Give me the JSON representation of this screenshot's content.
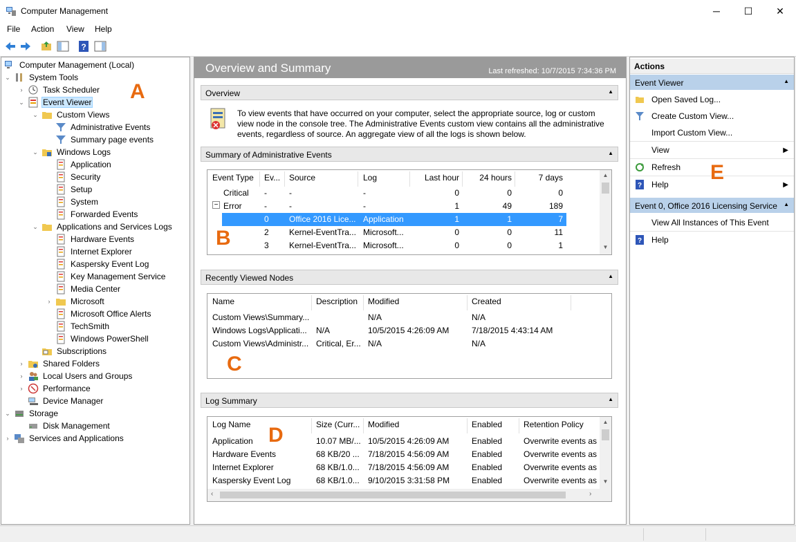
{
  "window": {
    "title": "Computer Management",
    "minimize": "─",
    "maximize": "☐",
    "close": "✕"
  },
  "menu": [
    "File",
    "Action",
    "View",
    "Help"
  ],
  "tree": {
    "root": "Computer Management (Local)",
    "items": [
      {
        "label": "System Tools"
      },
      {
        "label": "Task Scheduler"
      },
      {
        "label": "Event Viewer"
      },
      {
        "label": "Custom Views"
      },
      {
        "label": "Administrative Events"
      },
      {
        "label": "Summary page events"
      },
      {
        "label": "Windows Logs"
      },
      {
        "label": "Application"
      },
      {
        "label": "Security"
      },
      {
        "label": "Setup"
      },
      {
        "label": "System"
      },
      {
        "label": "Forwarded Events"
      },
      {
        "label": "Applications and Services Logs"
      },
      {
        "label": "Hardware Events"
      },
      {
        "label": "Internet Explorer"
      },
      {
        "label": "Kaspersky Event Log"
      },
      {
        "label": "Key Management Service"
      },
      {
        "label": "Media Center"
      },
      {
        "label": "Microsoft"
      },
      {
        "label": "Microsoft Office Alerts"
      },
      {
        "label": "TechSmith"
      },
      {
        "label": "Windows PowerShell"
      },
      {
        "label": "Subscriptions"
      },
      {
        "label": "Shared Folders"
      },
      {
        "label": "Local Users and Groups"
      },
      {
        "label": "Performance"
      },
      {
        "label": "Device Manager"
      },
      {
        "label": "Storage"
      },
      {
        "label": "Disk Management"
      },
      {
        "label": "Services and Applications"
      }
    ]
  },
  "main": {
    "title": "Overview and Summary",
    "refreshed": "Last refreshed: 10/7/2015 7:34:36 PM",
    "overview": {
      "header": "Overview",
      "text": "To view events that have occurred on your computer, select the appropriate source, log or custom view node in the console tree. The Administrative Events custom view contains all the administrative events, regardless of source. An aggregate view of all the logs is shown below."
    },
    "summary": {
      "header": "Summary of Administrative Events",
      "columns": [
        "Event Type",
        "Ev...",
        "Source",
        "Log",
        "Last hour",
        "24 hours",
        "7 days"
      ],
      "rows": [
        {
          "type": "Critical",
          "ev": "-",
          "source": "-",
          "log": "-",
          "hour": "0",
          "day": "0",
          "week": "0"
        },
        {
          "type": "Error",
          "ev": "-",
          "source": "-",
          "log": "-",
          "hour": "1",
          "day": "49",
          "week": "189"
        },
        {
          "type": "",
          "ev": "0",
          "source": "Office 2016 Lice...",
          "log": "Application",
          "hour": "1",
          "day": "1",
          "week": "7"
        },
        {
          "type": "",
          "ev": "2",
          "source": "Kernel-EventTra...",
          "log": "Microsoft...",
          "hour": "0",
          "day": "0",
          "week": "11"
        },
        {
          "type": "",
          "ev": "3",
          "source": "Kernel-EventTra...",
          "log": "Microsoft...",
          "hour": "0",
          "day": "0",
          "week": "1"
        }
      ],
      "expand_glyph": "−"
    },
    "recent": {
      "header": "Recently Viewed Nodes",
      "columns": [
        "Name",
        "Description",
        "Modified",
        "Created"
      ],
      "rows": [
        {
          "name": "Custom Views\\Summary...",
          "desc": "",
          "modified": "N/A",
          "created": "N/A"
        },
        {
          "name": "Windows Logs\\Applicati...",
          "desc": "N/A",
          "modified": "10/5/2015 4:26:09 AM",
          "created": "7/18/2015 4:43:14 AM"
        },
        {
          "name": "Custom Views\\Administr...",
          "desc": "Critical, Er...",
          "modified": "N/A",
          "created": "N/A"
        }
      ]
    },
    "logsummary": {
      "header": "Log Summary",
      "columns": [
        "Log Name",
        "Size (Curr...",
        "Modified",
        "Enabled",
        "Retention Policy"
      ],
      "rows": [
        {
          "name": "Application",
          "size": "10.07 MB/...",
          "modified": "10/5/2015 4:26:09 AM",
          "enabled": "Enabled",
          "policy": "Overwrite events as n"
        },
        {
          "name": "Hardware Events",
          "size": "68 KB/20 ...",
          "modified": "7/18/2015 4:56:09 AM",
          "enabled": "Enabled",
          "policy": "Overwrite events as n"
        },
        {
          "name": "Internet Explorer",
          "size": "68 KB/1.0...",
          "modified": "7/18/2015 4:56:09 AM",
          "enabled": "Enabled",
          "policy": "Overwrite events as n"
        },
        {
          "name": "Kaspersky Event Log",
          "size": "68 KB/1.0...",
          "modified": "9/10/2015 3:31:58 PM",
          "enabled": "Enabled",
          "policy": "Overwrite events as n"
        }
      ]
    }
  },
  "callouts": {
    "a": "A",
    "b": "B",
    "c": "C",
    "d": "D",
    "e": "E"
  },
  "actions": {
    "title": "Actions",
    "group1": "Event Viewer",
    "items1": [
      {
        "label": "Open Saved Log...",
        "icon": "folder-icon"
      },
      {
        "label": "Create Custom View...",
        "icon": "filter-icon"
      },
      {
        "label": "Import Custom View...",
        "icon": ""
      },
      {
        "label": "View",
        "icon": "",
        "submenu": true
      },
      {
        "label": "Refresh",
        "icon": "refresh-icon"
      },
      {
        "label": "Help",
        "icon": "help-icon",
        "submenu": true
      }
    ],
    "group2": "Event 0, Office 2016 Licensing Service",
    "items2": [
      {
        "label": "View All Instances of This Event",
        "icon": ""
      },
      {
        "label": "Help",
        "icon": "help-icon"
      }
    ]
  },
  "colors": {
    "selection": "#3399ff",
    "callout": "#e86a10",
    "action_header": "#b9d1ea"
  }
}
